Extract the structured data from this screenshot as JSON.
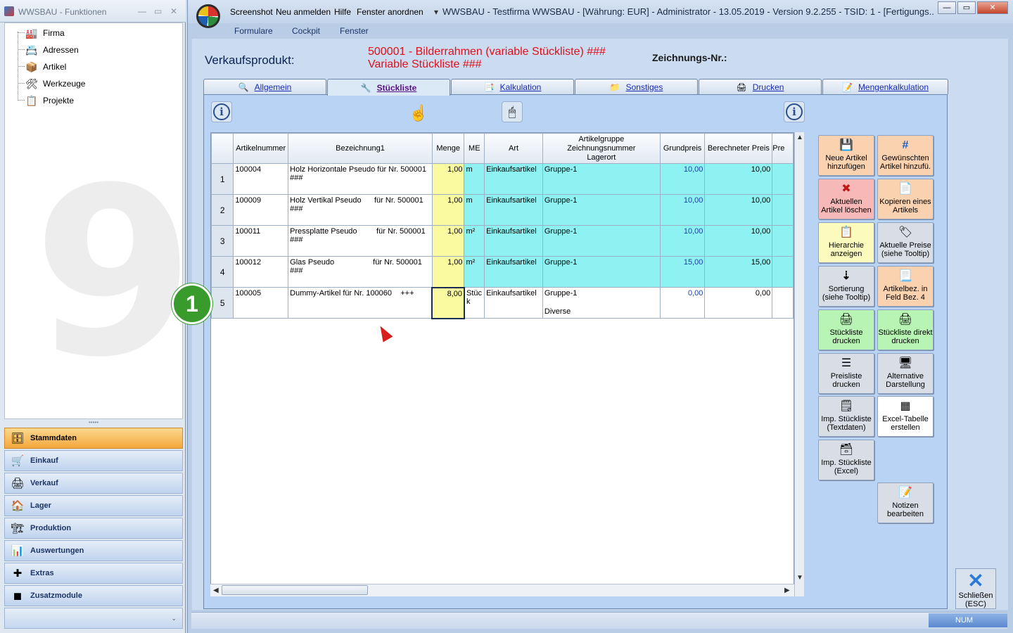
{
  "left_window": {
    "title": "WWSBAU - Funktionen",
    "tree": [
      {
        "label": "Firma",
        "icon": "factory-icon",
        "glyph": "🏭"
      },
      {
        "label": "Adressen",
        "icon": "address-card-icon",
        "glyph": "📇"
      },
      {
        "label": "Artikel",
        "icon": "box-icon",
        "glyph": "📦"
      },
      {
        "label": "Werkzeuge",
        "icon": "tools-icon",
        "glyph": "🛠"
      },
      {
        "label": "Projekte",
        "icon": "project-icon",
        "glyph": "📋"
      }
    ],
    "nav": [
      {
        "label": "Stammdaten",
        "icon": "cabinet-icon",
        "glyph": "🗄",
        "active": true
      },
      {
        "label": "Einkauf",
        "icon": "cart-icon",
        "glyph": "🛒"
      },
      {
        "label": "Verkauf",
        "icon": "register-icon",
        "glyph": "🖨"
      },
      {
        "label": "Lager",
        "icon": "warehouse-icon",
        "glyph": "🏠"
      },
      {
        "label": "Produktion",
        "icon": "production-icon",
        "glyph": "🏗"
      },
      {
        "label": "Auswertungen",
        "icon": "analysis-icon",
        "glyph": "📊"
      },
      {
        "label": "Extras",
        "icon": "extras-icon",
        "glyph": "✚"
      },
      {
        "label": "Zusatzmodule",
        "icon": "modules-icon",
        "glyph": "◼"
      }
    ]
  },
  "main_window": {
    "menu": [
      "Screenshot",
      "Neu anmelden",
      "Hilfe",
      "Fenster anordnen"
    ],
    "caption": "WWSBAU - Testfirma WWSBAU - [Währung: EUR] - Administrator - 13.05.2019 - Version 9.2.255 - TSID: 1 - [Fertigungs...",
    "submenu": [
      "Formulare",
      "Cockpit",
      "Fenster"
    ],
    "verkaufsprodukt_label": "Verkaufsprodukt:",
    "verkaufsprodukt_line1": "500001 - Bilderrahmen (variable Stückliste) ###",
    "verkaufsprodukt_line2": "Variable Stückliste ###",
    "zeichnungs_label": "Zeichnungs-Nr.:",
    "tabs": [
      {
        "label": "Allgemein",
        "icon": "general-tab-icon",
        "glyph": "🔍"
      },
      {
        "label": "Stückliste",
        "icon": "bom-tab-icon",
        "glyph": "🔧",
        "active": true
      },
      {
        "label": "Kalkulation",
        "icon": "calc-tab-icon",
        "glyph": "📑"
      },
      {
        "label": "Sonstiges",
        "icon": "misc-tab-icon",
        "glyph": "📁"
      },
      {
        "label": "Drucken",
        "icon": "print-tab-icon",
        "glyph": "🖨"
      },
      {
        "label": "Mengenkalkulation",
        "icon": "quantity-tab-icon",
        "glyph": "📝"
      }
    ],
    "columns": [
      "Artikelnummer",
      "Bezeichnung1",
      "Menge",
      "ME",
      "Art",
      "Artikelgruppe\nZeichnungsnummer\nLagerort",
      "Grundpreis",
      "Berechneter Preis",
      "Pre"
    ],
    "rows": [
      {
        "n": "1",
        "artnr": "100004",
        "bez": "Holz Horizontale Pseudo für Nr. 500001 ###",
        "menge": "1,00",
        "me": "m",
        "art": "Einkaufsartikel",
        "gruppe": "Gruppe-1",
        "gruppe2": "",
        "grund": "10,00",
        "ber": "10,00"
      },
      {
        "n": "2",
        "artnr": "100009",
        "bez": "Holz Vertikal Pseudo      für Nr. 500001 ###",
        "menge": "1,00",
        "me": "m",
        "art": "Einkaufsartikel",
        "gruppe": "Gruppe-1",
        "gruppe2": "",
        "grund": "10,00",
        "ber": "10,00"
      },
      {
        "n": "3",
        "artnr": "100011",
        "bez": "Pressplatte Pseudo         für Nr. 500001 ###",
        "menge": "1,00",
        "me": "m²",
        "art": "Einkaufsartikel",
        "gruppe": "Gruppe-1",
        "gruppe2": "",
        "grund": "10,00",
        "ber": "10,00"
      },
      {
        "n": "4",
        "artnr": "100012",
        "bez": "Glas Pseudo                  für Nr. 500001 ###",
        "menge": "1,00",
        "me": "m²",
        "art": "Einkaufsartikel",
        "gruppe": "Gruppe-1",
        "gruppe2": "",
        "grund": "15,00",
        "ber": "15,00"
      },
      {
        "n": "5",
        "artnr": "100005",
        "bez": "Dummy-Artikel für Nr. 100060    +++",
        "menge": "8,00",
        "me": "Stück",
        "art": "Einkaufsartikel",
        "gruppe": "Gruppe-1",
        "gruppe2": "Diverse",
        "grund": "0,00",
        "ber": "0,00"
      }
    ],
    "buttons": [
      {
        "label": "Neue Artikel hinzufügen",
        "name": "new-article-button",
        "icon": "save-icon",
        "glyph": "💾",
        "color": "c-peach"
      },
      {
        "label": "Gewünschten Artikel hinzufü.",
        "name": "add-desired-article-button",
        "icon": "hash-doc-icon",
        "glyph": "#",
        "color": "c-peach"
      },
      {
        "label": "Aktuellen Artikel löschen",
        "name": "delete-article-button",
        "icon": "delete-doc-icon",
        "glyph": "✖",
        "color": "c-pink"
      },
      {
        "label": "Kopieren eines Artikels",
        "name": "copy-article-button",
        "icon": "copy-icon",
        "glyph": "📄",
        "color": "c-peach"
      },
      {
        "label": "Hierarchie anzeigen",
        "name": "show-hierarchy-button",
        "icon": "hierarchy-icon",
        "glyph": "📋",
        "color": "c-ylw"
      },
      {
        "label": "Aktuelle Preise (siehe Tooltip)",
        "name": "current-prices-button",
        "icon": "tag-icon",
        "glyph": "🏷",
        "color": "c-grey"
      },
      {
        "label": "Sortierung (siehe Tooltip)",
        "name": "sorting-button",
        "icon": "sort-icon",
        "glyph": "⇣",
        "color": "c-grey"
      },
      {
        "label": "Artikelbez. in Feld Bez. 4",
        "name": "article-desc-field4-button",
        "icon": "doc-transfer-icon",
        "glyph": "📃",
        "color": "c-peach"
      },
      {
        "label": "Stückliste drucken",
        "name": "print-bom-button",
        "icon": "printer-icon",
        "glyph": "🖨",
        "color": "c-grn"
      },
      {
        "label": "Stückliste direkt drucken",
        "name": "print-bom-direct-button",
        "icon": "printer-direct-icon",
        "glyph": "🖨",
        "color": "c-grn"
      },
      {
        "label": "Preisliste drucken",
        "name": "print-pricelist-button",
        "icon": "list-icon",
        "glyph": "☰",
        "color": "c-grey"
      },
      {
        "label": "Alternative Darstellung",
        "name": "alternative-view-button",
        "icon": "presentation-icon",
        "glyph": "🖥",
        "color": "c-grey"
      },
      {
        "label": "Imp. Stückliste (Textdaten)",
        "name": "import-bom-text-button",
        "icon": "text-import-icon",
        "glyph": "🗒",
        "color": "c-grey"
      },
      {
        "label": "Excel-Tabelle erstellen",
        "name": "create-excel-button",
        "icon": "table-icon",
        "glyph": "▦",
        "color": "c-wht"
      },
      {
        "label": "Imp. Stückliste (Excel)",
        "name": "import-bom-excel-button",
        "icon": "excel-import-icon",
        "glyph": "🗃",
        "color": "c-grey"
      },
      {
        "label": "Notizen bearbeiten",
        "name": "edit-notes-button",
        "icon": "notes-icon",
        "glyph": "📝",
        "color": "c-grey"
      }
    ],
    "close_label": "Schließen (ESC)",
    "status_num": "NUM",
    "badge": "1"
  }
}
